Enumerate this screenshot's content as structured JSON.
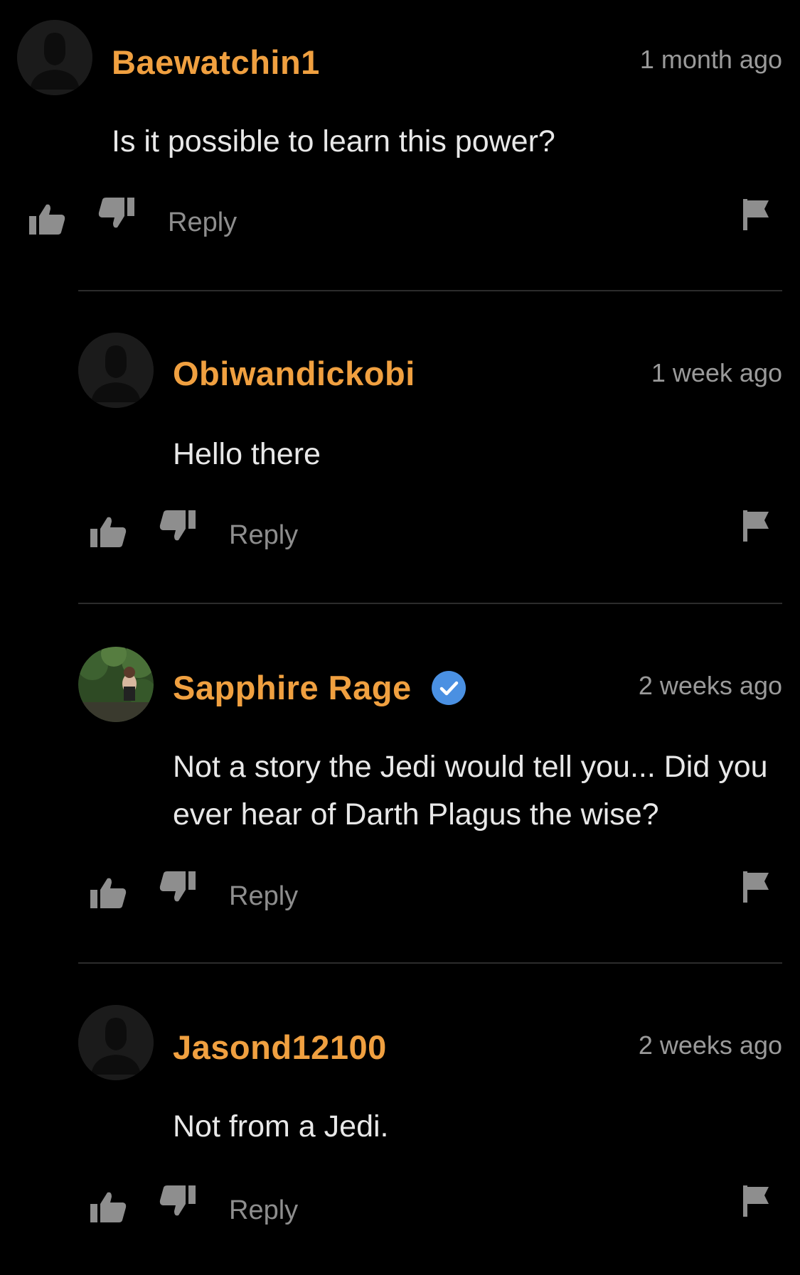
{
  "colors": {
    "background": "#000000",
    "username": "#f0a040",
    "timestamp": "#9a9a9a",
    "body": "#e8e8e8",
    "action": "#8e8e8e",
    "divider": "#2c2c2c",
    "verified_badge": "#4a90e2"
  },
  "comments": [
    {
      "username": "Baewatchin1",
      "timestamp": "1 month ago",
      "text": "Is it possible to learn this power?",
      "avatar": "default-avatar-icon",
      "verified": false,
      "reply_label": "Reply"
    },
    {
      "username": "Obiwandickobi",
      "timestamp": "1 week ago",
      "text": "Hello there",
      "avatar": "default-avatar-icon",
      "verified": false,
      "reply_label": "Reply"
    },
    {
      "username": "Sapphire Rage",
      "timestamp": "2 weeks ago",
      "text": "Not a story the Jedi would tell you... Did you ever hear of Darth Plagus the wise?",
      "avatar": "photo-avatar",
      "verified": true,
      "reply_label": "Reply"
    },
    {
      "username": "Jasond12100",
      "timestamp": "2 weeks ago",
      "text": "Not from a Jedi.",
      "avatar": "default-avatar-icon",
      "verified": false,
      "reply_label": "Reply"
    }
  ]
}
